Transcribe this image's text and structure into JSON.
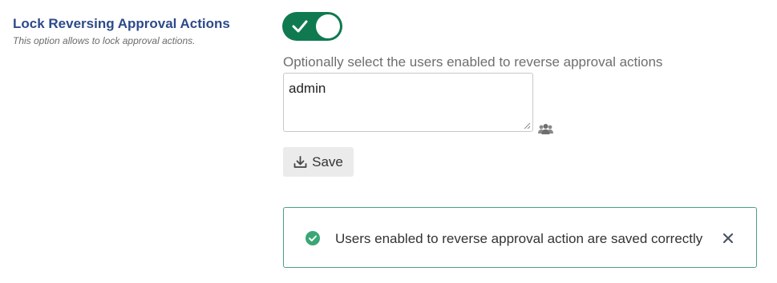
{
  "setting": {
    "title": "Lock Reversing Approval Actions",
    "description": "This option allows to lock approval actions.",
    "toggle_state": "on"
  },
  "users_field": {
    "label": "Optionally select the users enabled to reverse approval actions",
    "value": "admin"
  },
  "save_button": {
    "label": "Save"
  },
  "alert": {
    "message": "Users enabled to reverse approval action are saved correctly"
  },
  "colors": {
    "toggle_on": "#0f7a4f",
    "title": "#2d4a8a",
    "alert_border": "#4aa27e",
    "success_icon": "#3aa676"
  },
  "icons": {
    "toggle": "checkmark-icon",
    "users_picker": "users-group-icon",
    "save": "download-icon",
    "alert_status": "check-circle-icon",
    "alert_close": "close-icon"
  }
}
